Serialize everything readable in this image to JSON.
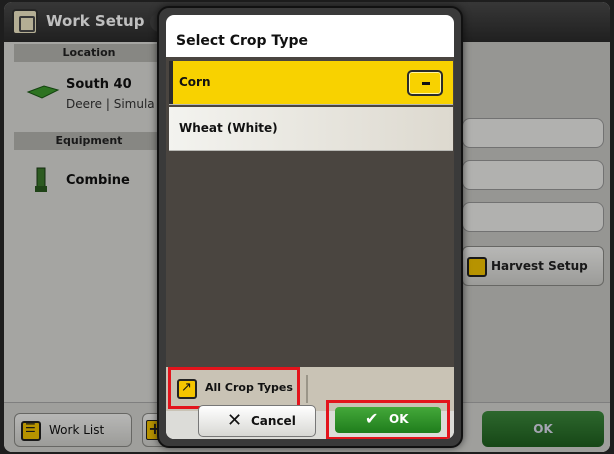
{
  "background": {
    "title": "Work Setup",
    "location_header": "Location",
    "field_name": "South 40",
    "field_sub": "Deere | Simula",
    "equipment_header": "Equipment",
    "equipment_name": "Combine",
    "harvest_setup_label": "Harvest Setup",
    "work_list_label": "Work List",
    "ok_label": "OK"
  },
  "dialog": {
    "title": "Select Crop Type",
    "items": [
      {
        "label": "Corn",
        "selected": true
      },
      {
        "label": "Wheat (White)",
        "selected": false
      }
    ],
    "all_crop_types_label": "All Crop Types",
    "cancel_label": "Cancel",
    "ok_label": "OK"
  },
  "colors": {
    "selection_yellow": "#f8d200",
    "highlight_red": "#e3141c",
    "ok_green": "#2f8f28"
  }
}
